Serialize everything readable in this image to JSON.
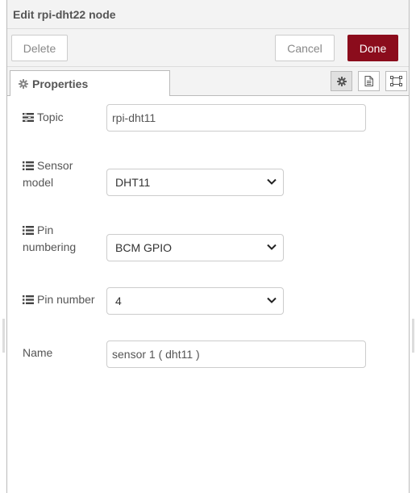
{
  "header": {
    "title": "Edit rpi-dht22 node"
  },
  "toolbar": {
    "delete_label": "Delete",
    "cancel_label": "Cancel",
    "done_label": "Done"
  },
  "tabs": {
    "properties_label": "Properties"
  },
  "icons": {
    "tab": "gear-icon",
    "tab_buttons": [
      "gear-icon",
      "document-icon",
      "frame-icon"
    ],
    "field": "list-icon"
  },
  "colors": {
    "primary": "#8b0c1c",
    "border": "#cccccc",
    "text": "#555555"
  },
  "form": {
    "topic": {
      "label": "Topic",
      "value": "rpi-dht11"
    },
    "sensor_model": {
      "label_line1": "Sensor",
      "label_line2": "model",
      "selected": "DHT11"
    },
    "pin_numbering": {
      "label_line1": "Pin",
      "label_line2": "numbering",
      "selected": "BCM GPIO"
    },
    "pin_number": {
      "label": "Pin number",
      "selected": "4"
    },
    "name": {
      "label": "Name",
      "value": "sensor 1 ( dht11 )"
    }
  }
}
